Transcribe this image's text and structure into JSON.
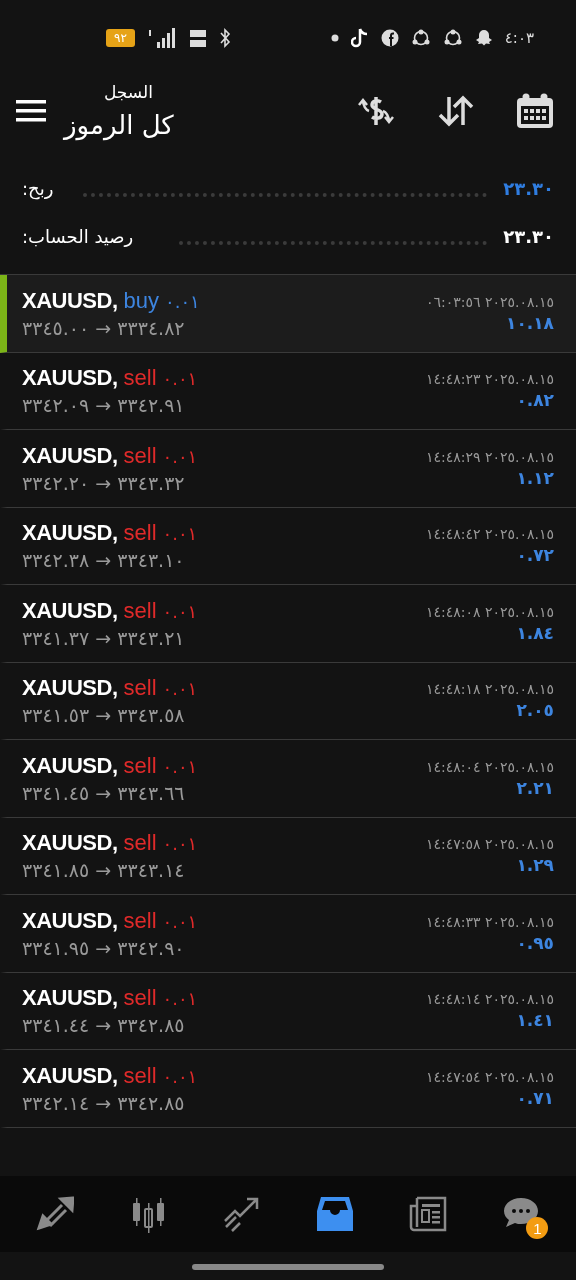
{
  "status_bar": {
    "battery": "٩٢",
    "time": "٤:٠٣"
  },
  "header": {
    "subtitle": "السجل",
    "title": "كل الرموز"
  },
  "summary": [
    {
      "label": "ربح:",
      "value": "٢٣.٣٠",
      "kind": "profit"
    },
    {
      "label": "رصيد الحساب:",
      "value": "٢٣.٣٠",
      "kind": "balance"
    }
  ],
  "deals": [
    {
      "symbol": "XAUUSD,",
      "side": "buy",
      "volume": "٠.٠١",
      "prices": "٣٣٤٥.٠٠ → ٣٣٣٤.٨٢",
      "time": "٠٦:٠٣:٥٦ ٢٠٢٥.٠٨.١٥",
      "profit": "١٠.١٨",
      "selected": true
    },
    {
      "symbol": "XAUUSD,",
      "side": "sell",
      "volume": "٠.٠١",
      "prices": "٣٣٤٢.٠٩ → ٣٣٤٢.٩١",
      "time": "١٤:٤٨:٢٣ ٢٠٢٥.٠٨.١٥",
      "profit": "٠.٨٢",
      "selected": false
    },
    {
      "symbol": "XAUUSD,",
      "side": "sell",
      "volume": "٠.٠١",
      "prices": "٣٣٤٢.٢٠ → ٣٣٤٣.٣٢",
      "time": "١٤:٤٨:٢٩ ٢٠٢٥.٠٨.١٥",
      "profit": "١.١٢",
      "selected": false
    },
    {
      "symbol": "XAUUSD,",
      "side": "sell",
      "volume": "٠.٠١",
      "prices": "٣٣٤٢.٣٨ → ٣٣٤٣.١٠",
      "time": "١٤:٤٨:٤٢ ٢٠٢٥.٠٨.١٥",
      "profit": "٠.٧٢",
      "selected": false
    },
    {
      "symbol": "XAUUSD,",
      "side": "sell",
      "volume": "٠.٠١",
      "prices": "٣٣٤١.٣٧ → ٣٣٤٣.٢١",
      "time": "١٤:٤٨:٠٨ ٢٠٢٥.٠٨.١٥",
      "profit": "١.٨٤",
      "selected": false
    },
    {
      "symbol": "XAUUSD,",
      "side": "sell",
      "volume": "٠.٠١",
      "prices": "٣٣٤١.٥٣ → ٣٣٤٣.٥٨",
      "time": "١٤:٤٨:١٨ ٢٠٢٥.٠٨.١٥",
      "profit": "٢.٠٥",
      "selected": false
    },
    {
      "symbol": "XAUUSD,",
      "side": "sell",
      "volume": "٠.٠١",
      "prices": "٣٣٤١.٤٥ → ٣٣٤٣.٦٦",
      "time": "١٤:٤٨:٠٤ ٢٠٢٥.٠٨.١٥",
      "profit": "٢.٢١",
      "selected": false
    },
    {
      "symbol": "XAUUSD,",
      "side": "sell",
      "volume": "٠.٠١",
      "prices": "٣٣٤١.٨٥ → ٣٣٤٣.١٤",
      "time": "١٤:٤٧:٥٨ ٢٠٢٥.٠٨.١٥",
      "profit": "١.٢٩",
      "selected": false
    },
    {
      "symbol": "XAUUSD,",
      "side": "sell",
      "volume": "٠.٠١",
      "prices": "٣٣٤١.٩٥ → ٣٣٤٢.٩٠",
      "time": "١٤:٤٨:٣٣ ٢٠٢٥.٠٨.١٥",
      "profit": "٠.٩٥",
      "selected": false
    },
    {
      "symbol": "XAUUSD,",
      "side": "sell",
      "volume": "٠.٠١",
      "prices": "٣٣٤١.٤٤ → ٣٣٤٢.٨٥",
      "time": "١٤:٤٨:١٤ ٢٠٢٥.٠٨.١٥",
      "profit": "١.٤١",
      "selected": false
    },
    {
      "symbol": "XAUUSD,",
      "side": "sell",
      "volume": "٠.٠١",
      "prices": "٣٣٤٢.١٤ → ٣٣٤٢.٨٥",
      "time": "١٤:٤٧:٥٤ ٢٠٢٥.٠٨.١٥",
      "profit": "٠.٧١",
      "selected": false
    }
  ],
  "nav": [
    {
      "kind": "trade",
      "selected": false
    },
    {
      "kind": "chart",
      "selected": false
    },
    {
      "kind": "trend",
      "selected": false
    },
    {
      "kind": "history",
      "selected": true
    },
    {
      "kind": "news",
      "selected": false
    },
    {
      "kind": "chat",
      "selected": false,
      "badge": "1"
    }
  ]
}
